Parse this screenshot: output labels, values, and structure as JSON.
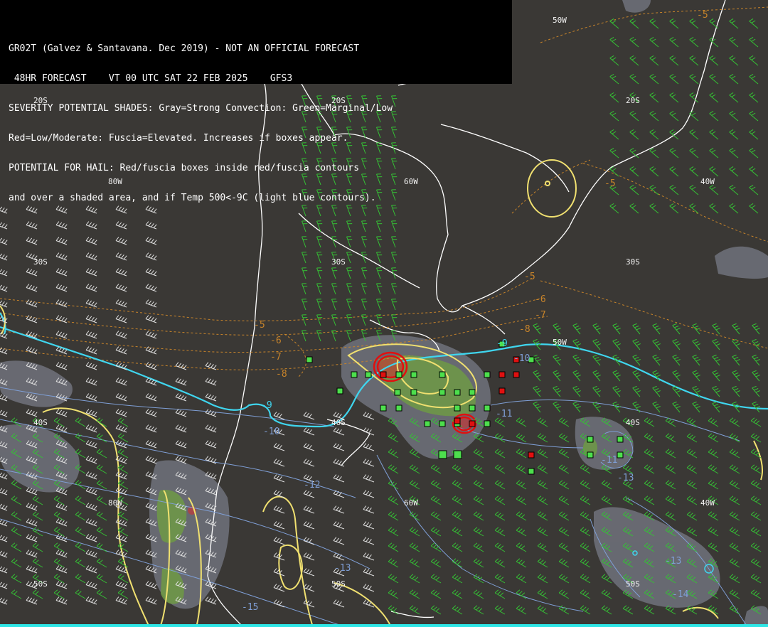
{
  "header": {
    "line1": "GR02T (Galvez & Santavana. Dec 2019) - NOT AN OFFICIAL FORECAST",
    "line2": " 48HR FORECAST    VT 00 UTC SAT 22 FEB 2025    GFS3",
    "line3": "SEVERITY POTENTIAL SHADES: Gray=Strong Convection: Green=Marginal/Low",
    "line4": "Red=Low/Moderate: Fuscia=Elevated. Increases if boxes appear.",
    "line5": "POTENTIAL FOR HAIL: Red/fuscia boxes inside red/fuscia contours",
    "line6": "and over a shaded area, and if Temp 500<-9C (light blue contours)."
  },
  "grid_labels": {
    "lat_20s_a": "20S",
    "lat_20s_b": "20S",
    "lat_20s_c": "20S",
    "lat_30s_a": "30S",
    "lat_30s_b": "30S",
    "lat_30s_c": "30S",
    "lat_40s_a": "40S",
    "lat_40s_b": "40S",
    "lat_40s_c": "40S",
    "lat_50s_a": "50S",
    "lat_50s_b": "50S",
    "lat_50s_c": "50S",
    "lon_80w_a": "80W",
    "lon_80w_b": "80W",
    "lon_60w_a": "60W",
    "lon_60w_b": "60W",
    "lon_50w_a": "50W",
    "lon_50w_b": "50W",
    "lon_40w_a": "40W",
    "lon_40w_b": "40W"
  },
  "temp_labels": {
    "t_m5_ne": "-5",
    "t_m5_e": "-5",
    "t_m5_mid": "-5",
    "t_m5_w": "-5",
    "t_m6_a": "-6",
    "t_m6_b": "-6",
    "t_m7_a": "-7",
    "t_m7_b": "-7",
    "t_m8_a": "-8",
    "t_m8_b": "-8",
    "t_m9_a": "-9",
    "t_m9_b": "-9",
    "t_m10": "-10",
    "t_m10_b": "-10",
    "t_m11_a": "-11",
    "t_m11_b": "-11",
    "t_m12": "-12",
    "t_m13_a": "-13",
    "t_m13_b": "-13",
    "t_m13_c": "-13",
    "t_m14": "-14",
    "t_m15": "-15"
  },
  "colors": {
    "background": "#3a3835",
    "coastline": "#ffffff",
    "temp_500_contour": "#3fd6ef",
    "temp_contour_warm": "#c8842a",
    "temp_contour_cold": "#7f9fd6",
    "yellow_contour": "#f0e070",
    "severity_gray": "#6d6f78",
    "severity_green": "#6f9a45",
    "box_green": "#4ddf4d",
    "box_red": "#e01010",
    "wind_barb_green": "#35c235",
    "wind_barb_white": "#e0e0e0"
  }
}
